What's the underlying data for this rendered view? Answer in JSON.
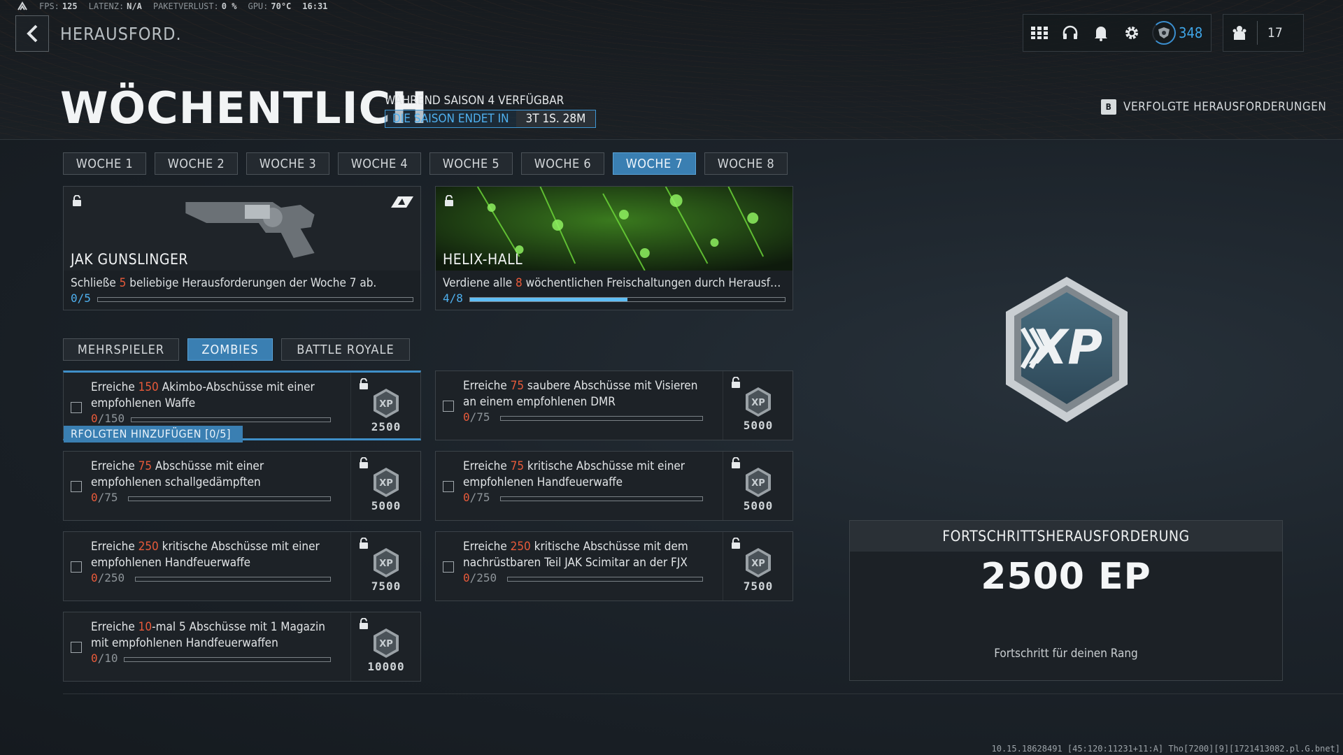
{
  "status": {
    "fps_label": "FPS:",
    "fps": "125",
    "latency_label": "LATENZ:",
    "latency": "N/A",
    "loss_label": "PAKETVERLUST:",
    "loss": "0 %",
    "gpu_label": "GPU:",
    "gpu": "70°C",
    "time": "16:31"
  },
  "header": {
    "breadcrumb": "HERAUSFORD.",
    "title": "WÖCHENTLICH",
    "season_note": "WÄHREND SAISON 4 VERFÜGBAR",
    "season_end_label": "DIE SAISON ENDET IN",
    "season_end_value": "3T 1S. 28M",
    "tracked_key": "B",
    "tracked_label": "VERFOLGTE HERAUSFORDERUNGEN",
    "cod_points": "348",
    "friends_count": "17"
  },
  "weeks": [
    "WOCHE 1",
    "WOCHE 2",
    "WOCHE 3",
    "WOCHE 4",
    "WOCHE 5",
    "WOCHE 6",
    "WOCHE 7",
    "WOCHE 8"
  ],
  "active_week_index": 6,
  "rewards": [
    {
      "name": "JAK GUNSLINGER",
      "desc_pre": "Schließe ",
      "desc_num": "5",
      "desc_post": " beliebige Herausforderungen der Woche 7 ab.",
      "progress": "0/5",
      "fill": 0.0
    },
    {
      "name": "HELIX-HALL",
      "desc_pre": "Verdiene alle ",
      "desc_num": "8",
      "desc_post": " wöchentlichen Freischaltungen durch Herausforderungen",
      "progress": "4/8",
      "fill": 0.5
    }
  ],
  "modes": [
    "MEHRSPIELER",
    "ZOMBIES",
    "BATTLE ROYALE"
  ],
  "active_mode_index": 1,
  "challenges": [
    {
      "pre": "Erreiche ",
      "num": "150",
      "post": " Akimbo-Abschüsse mit einer empfohlenen Waffe",
      "cur": "0",
      "total": "/150",
      "reward": "2500"
    },
    {
      "pre": "Erreiche ",
      "num": "75",
      "post": " saubere Abschüsse mit Visieren an einem empfohlenen DMR",
      "cur": "0",
      "total": "/75",
      "reward": "5000"
    },
    {
      "pre": "Erreiche ",
      "num": "75",
      "post": " Abschüsse mit einer empfohlenen schallgedämpften",
      "cur": "0",
      "total": "/75",
      "reward": "5000"
    },
    {
      "pre": "Erreiche ",
      "num": "75",
      "post": " kritische Abschüsse mit einer empfohlenen Handfeuerwaffe",
      "cur": "0",
      "total": "/75",
      "reward": "5000"
    },
    {
      "pre": "Erreiche ",
      "num": "250",
      "post": " kritische Abschüsse mit einer empfohlenen Handfeuerwaffe",
      "cur": "0",
      "total": "/250",
      "reward": "7500"
    },
    {
      "pre": "Erreiche ",
      "num": "250",
      "post": " kritische Abschüsse mit dem nachrüstbaren Teil JAK Scimitar an der FJX",
      "cur": "0",
      "total": "/250",
      "reward": "7500"
    },
    {
      "pre": "Erreiche ",
      "num": "10",
      "post": "-mal 5 Abschüsse mit 1 Magazin mit empfohlenen Handfeuerwaffen",
      "cur": "0",
      "total": "/10",
      "reward": "10000"
    }
  ],
  "track_add_label": "RFOLGTEN HINZUFÜGEN [0/5]",
  "progress_panel": {
    "title": "FORTSCHRITTSHERAUSFORDERUNG",
    "amount": "2500 EP",
    "subtitle": "Fortschritt für deinen Rang"
  },
  "build_string": "10.15.18628491 [45:120:11231+11:A] Tho[7200][9][1721413082.pl.G.bnet]",
  "colors": {
    "accent": "#3a7fb2",
    "highlight": "#e85a3a",
    "progress_blue": "#5fbef5"
  }
}
